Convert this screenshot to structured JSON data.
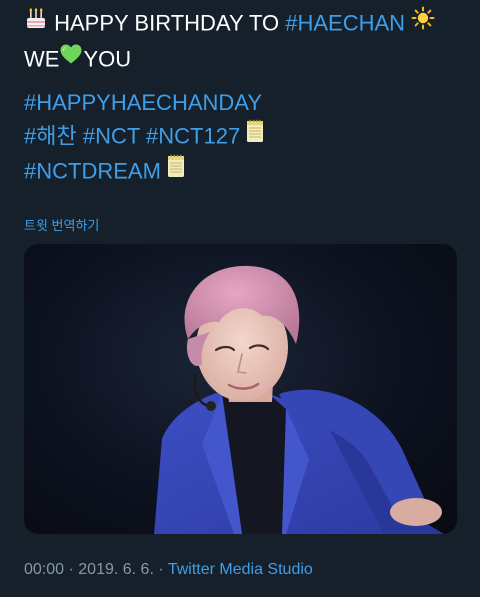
{
  "tweet": {
    "line1_text": "HAPPY BIRTHDAY TO",
    "line1_tag": "#HAECHAN",
    "line2_before": "WE",
    "line2_after": "YOU",
    "hashtag_happy": "#HAPPYHAECHANDAY",
    "hashtag_korean": "#해찬",
    "hashtag_nct": "#NCT",
    "hashtag_nct127": "#NCT127",
    "hashtag_nctdream": "#NCTDREAM",
    "translate_link": "트윗 번역하기",
    "time": "00:00",
    "separator": "·",
    "date": "2019. 6. 6.",
    "source": "Twitter Media Studio"
  },
  "icons": {
    "cake": "birthday-cake-icon",
    "sun": "sun-icon",
    "heart": "green-heart-icon",
    "calendar": "calendar-icon"
  },
  "colors": {
    "background": "#15202b",
    "link": "#3f9ee8",
    "muted": "#8899a6",
    "heart": "#6fd65a"
  }
}
